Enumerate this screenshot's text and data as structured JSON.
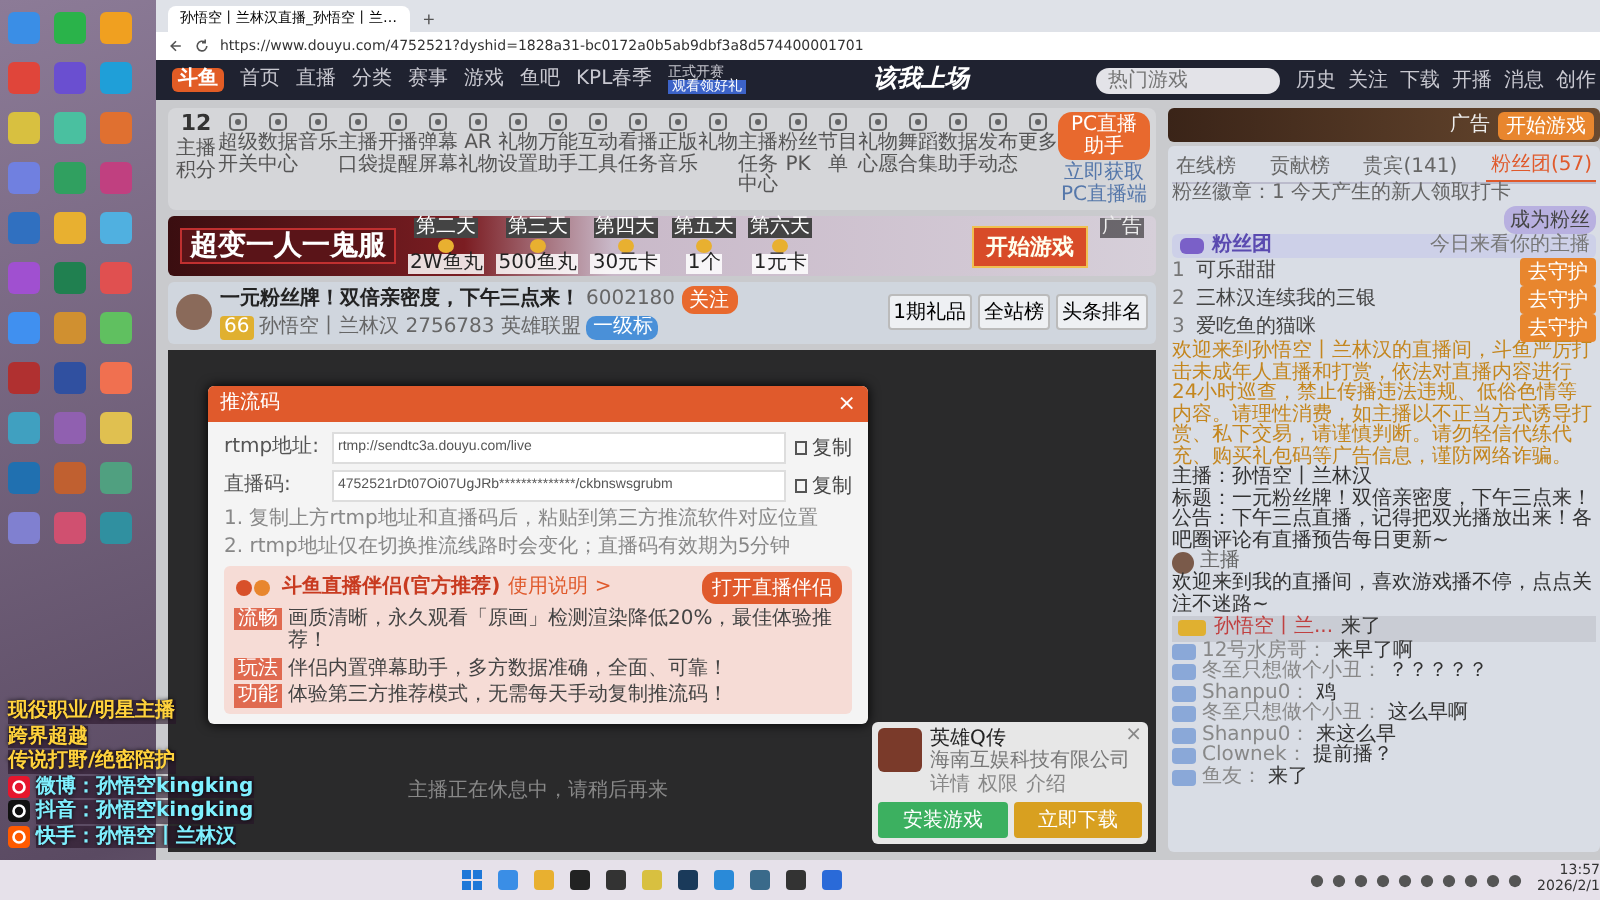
{
  "desktop_overlay": {
    "slogans": [
      "现役职业/明星主播",
      "跨界超越",
      "传说打野/绝密陪护"
    ],
    "socials": [
      {
        "kind": "weibo",
        "platform": "微博：",
        "handle": "孙悟空kingking"
      },
      {
        "kind": "douyin",
        "platform": "抖音：",
        "handle": "孙悟空kingking"
      },
      {
        "kind": "kuaishou",
        "platform": "快手：",
        "handle": "孙悟空丨兰林汉"
      }
    ]
  },
  "browser": {
    "tab_title": "孙悟空丨兰林汉直播_孙悟空丨兰…",
    "new_tab": "+",
    "url": "https://www.douyu.com/4752521?dyshid=1828a31-bc0172a0b5ab9dbf3a8d574400001701"
  },
  "nav": {
    "logo": "斗鱼",
    "items": [
      "首页",
      "直播",
      "分类",
      "赛事",
      "游戏",
      "鱼吧",
      "KPL春季"
    ],
    "promo_top": "正式开赛",
    "promo_bottom": "观看领好礼",
    "center_title": "该我上场",
    "search": {
      "placeholder": "热门游戏"
    },
    "actions": [
      "历史",
      "关注",
      "下载",
      "开播",
      "消息",
      "创作"
    ]
  },
  "tools": {
    "score": "12",
    "score_label": "主播积分",
    "items": [
      "超级开关",
      "数据中心",
      "音乐",
      "主播口袋",
      "开播提醒",
      "弹幕屏幕",
      "AR礼物",
      "礼物设置",
      "万能助手",
      "互动工具",
      "看播任务",
      "正版音乐",
      "礼物",
      "主播任务中心",
      "粉丝PK",
      "节目单",
      "礼物心愿",
      "舞蹈合集",
      "数据助手",
      "发布动态",
      "更多"
    ],
    "pc_button": "PC直播助手",
    "pc_link": "立即获取PC直播端"
  },
  "banner": {
    "title": "超变一人一鬼服",
    "rewards": [
      {
        "day": "第二天",
        "prize": "2W鱼丸"
      },
      {
        "day": "第三天",
        "prize": "500鱼丸"
      },
      {
        "day": "第四天",
        "prize": "30元卡"
      },
      {
        "day": "第五天",
        "prize": "1个"
      },
      {
        "day": "第六天",
        "prize": "1元卡"
      }
    ],
    "button": "开始游戏",
    "ad_label": "广告"
  },
  "room": {
    "title": "一元粉丝牌！双倍亲密度，下午三点来！",
    "room_id": "6002180",
    "follow": "关注",
    "level": "66",
    "anchor": "孙悟空丨兰林汉",
    "hot": "2756783",
    "category": "英雄联盟",
    "tag": "一级标",
    "buttons": [
      "1期礼品",
      "全站榜",
      "头条排名"
    ]
  },
  "video": {
    "status": "主播正在休息中，请稍后再来"
  },
  "modal": {
    "title": "推流码",
    "close": "×",
    "fields": [
      {
        "label": "rtmp地址:",
        "value": "rtmp://sendtc3a.douyu.com/live",
        "copy": "复制"
      },
      {
        "label": "直播码:",
        "value": "4752521rDt07Oi07UgJRb**************/ckbnswsgrubm",
        "copy": "复制"
      }
    ],
    "notes": [
      "1. 复制上方rtmp地址和直播码后，粘贴到第三方推流软件对应位置",
      "2. rtmp地址仅在切换推流线路时会变化；直播码有效期为5分钟"
    ],
    "promo": {
      "title": "斗鱼直播伴侣(官方推荐)",
      "link": "使用说明 >",
      "button": "打开直播伴侣",
      "rows": [
        {
          "tag": "流畅",
          "text": "画质清晰，永久观看「原画」检测渲染降低20%，最佳体验推荐！"
        },
        {
          "tag": "玩法",
          "text": "伴侣内置弹幕助手，多方数据准确，全面、可靠！"
        },
        {
          "tag": "功能",
          "text": "体验第三方推荐模式，无需每天手动复制推流码！"
        }
      ]
    }
  },
  "float_ad": {
    "close": "×",
    "name": "英雄Q传",
    "company": "海南互娱科技有限公司",
    "links": [
      "详情",
      "权限",
      "介绍"
    ],
    "buttons": [
      {
        "kind": "install",
        "label": "安装游戏"
      },
      {
        "kind": "download",
        "label": "立即下载"
      }
    ]
  },
  "side_ad": {
    "label": "广告",
    "button": "开始游戏"
  },
  "chat": {
    "tabs": [
      {
        "label": "在线榜",
        "selected": false
      },
      {
        "label": "贡献榜",
        "selected": false
      },
      {
        "label": "贵宾(141)",
        "selected": false
      },
      {
        "label": "粉丝团(57)",
        "selected": true
      }
    ],
    "badge_info": "粉丝徽章：1",
    "badge_hint": "今天产生的新人领取打卡",
    "join_button": "成为粉丝",
    "group_title": "粉丝团",
    "group_hint": "今日来看你的主播",
    "ranks": [
      {
        "rank": "1",
        "name": "可乐甜甜",
        "button": "去守护"
      },
      {
        "rank": "2",
        "name": "三林汉连续我的三银",
        "button": "去守护"
      },
      {
        "rank": "3",
        "name": "爱吃鱼的猫咪",
        "button": "去守护"
      }
    ],
    "notice": "欢迎来到孙悟空丨兰林汉的直播间，斗鱼严厉打击未成年人直播和打赏，依法对直播内容进行24小时巡查，禁止传播违法违规、低俗色情等内容。请理性消费，如主播以不正当方式诱导打赏、私下交易，请谨慎判断。请勿轻信代练代充、购买礼包码等广告信息，谨防网络诈骗。",
    "info": [
      "主播：孙悟空丨兰林汉",
      "标题：一元粉丝牌！双倍亲密度，下午三点来！",
      "公告：下午三点直播，记得把双光播放出来！各吧圈评论有直播预告每日更新~"
    ],
    "welcome_user": "主播",
    "welcome": "欢迎来到我的直播间，喜欢游戏播不停，点点关注不迷路~",
    "entry": {
      "name": "孙悟空丨兰...",
      "text": "来了"
    },
    "messages": [
      {
        "name": "12号水房哥：",
        "text": "来早了啊"
      },
      {
        "name": "冬至只想做个小丑：",
        "text": "？？？？？"
      },
      {
        "name": "Shanpu0：",
        "text": "鸡"
      },
      {
        "name": "冬至只想做个小丑：",
        "text": "这么早啊"
      },
      {
        "name": "Shanpu0：",
        "text": "来这么早"
      },
      {
        "name": "Clownek：",
        "text": "提前播？"
      },
      {
        "name": "鱼友：",
        "text": "来了"
      }
    ]
  },
  "taskbar": {
    "time": "13:57",
    "date": "2026/2/1"
  }
}
